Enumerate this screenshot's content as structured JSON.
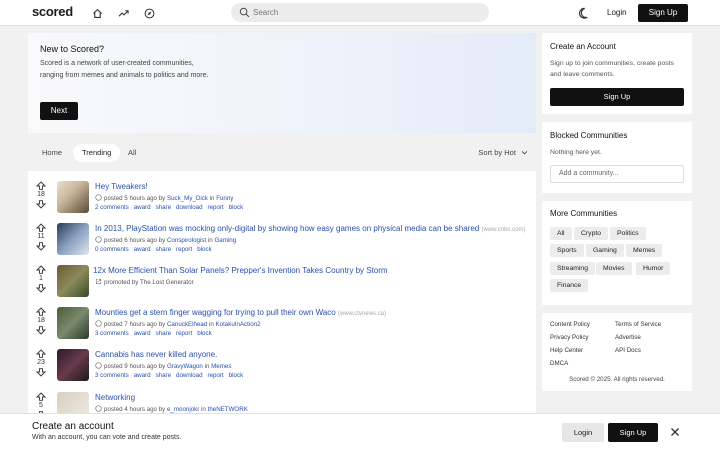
{
  "header": {
    "logo": "scored",
    "search_placeholder": "Search",
    "login": "Login",
    "signup": "Sign Up",
    "nav_icons": [
      "home-icon",
      "trending-icon",
      "explore-icon"
    ]
  },
  "hero": {
    "title": "New to Scored?",
    "text": "Scored is a network of user-created communities, ranging from memes and animals to politics and more.",
    "next": "Next"
  },
  "tabs": [
    "Home",
    "Trending",
    "All"
  ],
  "active_tab": "Trending",
  "sort_label": "Sort by Hot",
  "posts": [
    {
      "score": "18",
      "title": "Hey Tweakers!",
      "domain": "",
      "posted": "posted 5 hours ago by",
      "author": "Suck_My_Dick",
      "in": "in",
      "community": "Funny",
      "actions": [
        "2 comments",
        "award",
        "share",
        "download",
        "report",
        "block"
      ]
    },
    {
      "score": "11",
      "title": "In 2013, PlayStation was mocking only-digital by showing how easy games on physical media can be shared",
      "domain": "(www.cnbc.com)",
      "posted": "posted 6 hours ago by",
      "author": "Conspirologist",
      "in": "in",
      "community": "Gaming",
      "actions": [
        "0 comments",
        "award",
        "share",
        "report",
        "block"
      ]
    },
    {
      "score": "1",
      "title": "12x More Efficient Than Solar Panels? Prepper's Invention Takes Country by Storm",
      "domain": "",
      "posted": "promoted by The Lost Generator",
      "author": "",
      "in": "",
      "community": "",
      "actions": []
    },
    {
      "score": "18",
      "title": "Mounties get a stern finger wagging for trying to pull their own Waco",
      "domain": "(www.ctvnews.ca)",
      "posted": "posted 7 hours ago by",
      "author": "CanuckElhead",
      "in": "in",
      "community": "KotakuInAction2",
      "actions": [
        "3 comments",
        "award",
        "share",
        "report",
        "block"
      ]
    },
    {
      "score": "23",
      "title": "Cannabis has never killed anyone.",
      "domain": "",
      "posted": "posted 9 hours ago by",
      "author": "GravyWagon",
      "in": "in",
      "community": "Memes",
      "actions": [
        "3 comments",
        "award",
        "share",
        "download",
        "report",
        "block"
      ]
    },
    {
      "score": "5",
      "title": "Networking",
      "domain": "",
      "posted": "posted 4 hours ago by",
      "author": "e_moonjokr",
      "in": "in",
      "community": "theNETWORK",
      "actions": []
    }
  ],
  "create_account": {
    "title": "Create an Account",
    "text": "Sign up to join communities, create posts and leave comments.",
    "button": "Sign Up"
  },
  "blocked": {
    "title": "Blocked Communities",
    "empty": "Nothing here yet.",
    "placeholder": "Add a community..."
  },
  "more": {
    "title": "More Communities",
    "chips": [
      "All",
      "Crypto",
      "Politics",
      "Sports",
      "Gaming",
      "Memes",
      "Streaming",
      "Movies",
      "Humor",
      "Finance"
    ]
  },
  "footer": {
    "links": [
      "Content Policy",
      "Terms of Service",
      "Privacy Policy",
      "Advertise",
      "Help Center",
      "API Docs",
      "DMCA"
    ],
    "copyright": "Scored © 2025. All rights reserved."
  },
  "bottom_bar": {
    "title": "Create an account",
    "text": "With an account, you can vote and create posts.",
    "login": "Login",
    "signup": "Sign Up"
  },
  "colors": {
    "link": "#2a4fb0",
    "dark_button": "#111111",
    "page_bg": "#f1f1f2"
  }
}
